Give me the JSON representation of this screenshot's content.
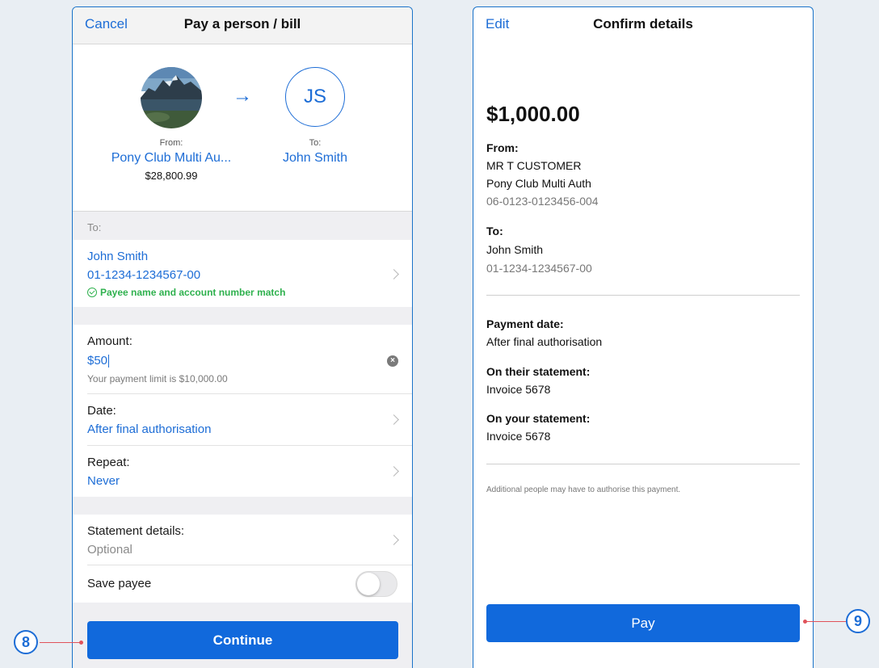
{
  "left_screen": {
    "nav": {
      "cancel": "Cancel",
      "title": "Pay a person / bill"
    },
    "from": {
      "label": "From:",
      "account": "Pony Club Multi Au...",
      "balance": "$28,800.99"
    },
    "to_avatar": {
      "initials": "JS",
      "label": "To:",
      "name": "John Smith"
    },
    "arrow_icon": "right-arrow-icon",
    "to_section": {
      "header": "To:",
      "payee_name": "John Smith",
      "account_number": "01-1234-1234567-00",
      "match_text": "Payee name and account number match"
    },
    "amount": {
      "label": "Amount:",
      "value": "$50",
      "limit": "Your payment limit is $10,000.00"
    },
    "date": {
      "label": "Date:",
      "value": "After final authorisation"
    },
    "repeat": {
      "label": "Repeat:",
      "value": "Never"
    },
    "statement": {
      "label": "Statement details:",
      "value": "Optional"
    },
    "save_payee": {
      "label": "Save payee",
      "on": false
    },
    "continue_label": "Continue"
  },
  "right_screen": {
    "nav": {
      "edit": "Edit",
      "title": "Confirm details"
    },
    "amount": "$1,000.00",
    "from": {
      "label": "From:",
      "name": "MR T CUSTOMER",
      "account_name": "Pony Club Multi Auth",
      "account_number": "06-0123-0123456-004"
    },
    "to": {
      "label": "To:",
      "name": "John Smith",
      "account_number": "01-1234-1234567-00"
    },
    "payment_date": {
      "label": "Payment date:",
      "value": "After final authorisation"
    },
    "their_statement": {
      "label": "On their statement:",
      "value": "Invoice 5678"
    },
    "your_statement": {
      "label": "On your statement:",
      "value": "Invoice 5678"
    },
    "note": "Additional people may have to authorise this payment.",
    "pay_label": "Pay"
  },
  "callouts": {
    "step_8": "8",
    "step_9": "9"
  },
  "colors": {
    "accent": "#1d6dd6",
    "button": "#1169dc",
    "success": "#2fb14e",
    "callout_line": "#e0525a"
  }
}
